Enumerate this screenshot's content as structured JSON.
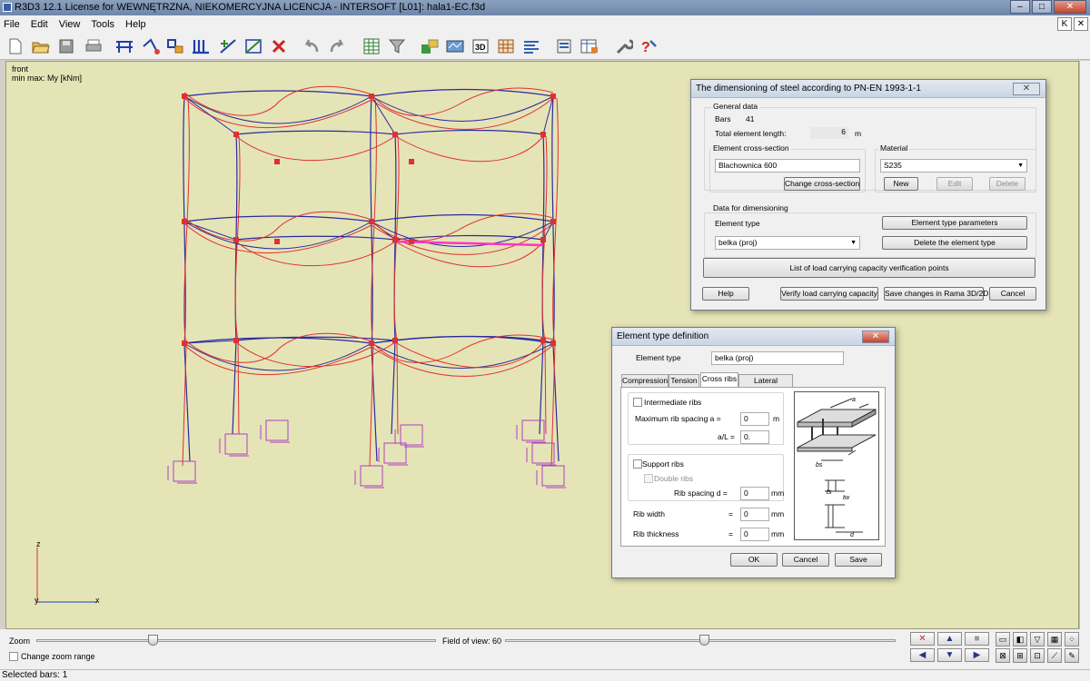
{
  "window": {
    "title": "R3D3 12.1 License for WEWNĘTRZNA, NIEKOMERCYJNA LICENCJA - INTERSOFT [L01]: hala1-EC.f3d",
    "minimize": "–",
    "maximize": "□",
    "close": "✕"
  },
  "menu": {
    "items": [
      "File",
      "Edit",
      "View",
      "Tools",
      "Help"
    ],
    "right_buttons": [
      "K",
      "✕"
    ]
  },
  "toolbar": {
    "icons": [
      "new-file",
      "open-file",
      "save",
      "print",
      "add-bars",
      "nodes",
      "copy-bars",
      "columns",
      "divide",
      "select-nodes",
      "delete",
      "undo",
      "redo",
      "table",
      "filter",
      "calculate",
      "results",
      "3d-view",
      "grid",
      "layers",
      "dimension",
      "tables",
      "settings",
      "help"
    ]
  },
  "canvas": {
    "view": "front",
    "result": "min max: My [kNm]",
    "axis_z": "z",
    "axis_y": "y",
    "axis_x": "x",
    "colors": {
      "background": "#e5e4b6",
      "frame": "#2a2aa0",
      "diagram": "#e03030",
      "highlight": "#ff33cc",
      "supports": "#b040c0"
    }
  },
  "bottom": {
    "zoom_label": "Zoom",
    "change_zoom_label": "Change zoom range",
    "fov_label": "Field of view: 60",
    "zoom_level": 0.29,
    "fov_level": 0.51
  },
  "status": {
    "text": "Selected bars: 1"
  },
  "dim_dialog": {
    "title": "The dimensioning of steel according to PN-EN 1993-1-1",
    "close": "✕",
    "general_data_label": "General data",
    "bars_label": "Bars",
    "bars_value": "41",
    "length_label": "Total element length:",
    "length_value": "6",
    "length_unit": "m",
    "cross_section_label": "Element cross-section",
    "cross_section_value": "Blachownica 600",
    "change_cs_button": "Change cross-section",
    "material_label": "Material",
    "material_value": "S235",
    "new_button": "New",
    "edit_button": "Edit",
    "delete_button": "Delete",
    "data_dim_label": "Data for dimensioning",
    "element_type_label": "Element type",
    "element_type_value": "belka (proj)",
    "element_type_params_button": "Element type parameters",
    "delete_element_type_button": "Delete the element type",
    "list_points_button": "List of load carrying capacity verification points",
    "help_button": "Help",
    "verify_button": "Verify load carrying capacity",
    "save_changes_button": "Save changes in Rama 3D/2D",
    "cancel_button": "Cancel"
  },
  "etype_dialog": {
    "title": "Element type definition",
    "close": "✕",
    "element_type_label": "Element type",
    "element_type_value": "belka (proj)",
    "tabs": [
      "Compression",
      "Tension",
      "Cross ribs",
      "Lateral buckling"
    ],
    "active_tab": 2,
    "intermediate_ribs_label": "Intermediate ribs",
    "max_spacing_label": "Maximum rib spacing a =",
    "max_spacing_value": "0",
    "max_spacing_unit": "m",
    "a_l_label": "a/L =",
    "a_l_value": "0.",
    "support_ribs_label": "Support ribs",
    "double_ribs_label": "Double ribs",
    "rib_spacing_label": "Rib spacing d =",
    "rib_spacing_value": "0",
    "rib_spacing_unit": "mm",
    "rib_width_label": "Rib width",
    "rib_width_eq": "=",
    "rib_width_value": "0",
    "rib_width_unit": "mm",
    "rib_thickness_label": "Rib thickness",
    "rib_thickness_eq": "=",
    "rib_thickness_value": "0",
    "rib_thickness_unit": "mm",
    "ok_button": "OK",
    "cancel_button": "Cancel",
    "save_button": "Save",
    "figure_labels": {
      "a": "a",
      "bs": "bs",
      "ts": "ts",
      "tw": "tw",
      "d": "d"
    }
  }
}
